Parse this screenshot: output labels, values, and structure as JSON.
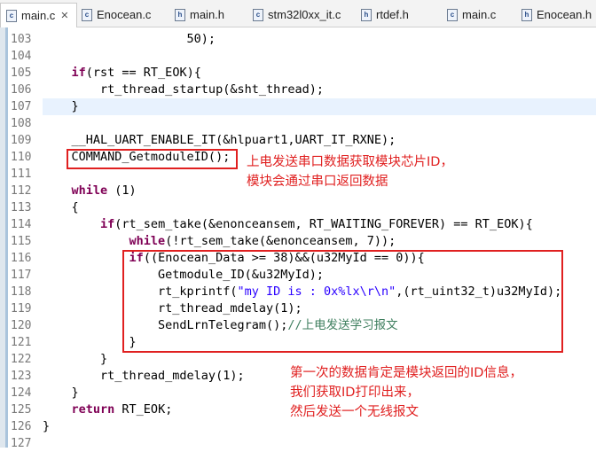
{
  "tabs": [
    {
      "label": "main.c",
      "icon": "c-file-icon",
      "glyph": "c",
      "active": true
    },
    {
      "label": "Enocean.c",
      "icon": "c-file-icon",
      "glyph": "c",
      "active": false
    },
    {
      "label": "main.h",
      "icon": "h-file-icon",
      "glyph": "h",
      "active": false
    },
    {
      "label": "stm32l0xx_it.c",
      "icon": "c-file-icon",
      "glyph": "c",
      "active": false
    },
    {
      "label": "rtdef.h",
      "icon": "h-file-icon",
      "glyph": "h",
      "active": false
    },
    {
      "label": "main.c",
      "icon": "c-file-icon",
      "glyph": "c",
      "active": false
    },
    {
      "label": "Enocean.h",
      "icon": "h-file-icon",
      "glyph": "h",
      "active": false
    }
  ],
  "close_glyph": "✕",
  "code_lines": [
    {
      "num": "103",
      "segs": [
        {
          "t": "                    50);"
        }
      ]
    },
    {
      "num": "104",
      "segs": [
        {
          "t": ""
        }
      ]
    },
    {
      "num": "105",
      "segs": [
        {
          "t": "    ",
          "c": ""
        },
        {
          "t": "if",
          "c": "kw"
        },
        {
          "t": "(rst == RT_EOK){"
        }
      ]
    },
    {
      "num": "106",
      "segs": [
        {
          "t": "        rt_thread_startup(&sht_thread);"
        }
      ]
    },
    {
      "num": "107",
      "segs": [
        {
          "t": "    }"
        }
      ]
    },
    {
      "num": "108",
      "segs": [
        {
          "t": ""
        }
      ]
    },
    {
      "num": "109",
      "segs": [
        {
          "t": "    __HAL_UART_ENABLE_IT(&hlpuart1,UART_IT_RXNE);"
        }
      ]
    },
    {
      "num": "110",
      "segs": [
        {
          "t": "    COMMAND_GetmoduleID();"
        }
      ]
    },
    {
      "num": "111",
      "segs": [
        {
          "t": ""
        }
      ]
    },
    {
      "num": "112",
      "segs": [
        {
          "t": "    "
        },
        {
          "t": "while",
          "c": "kw"
        },
        {
          "t": " (1)"
        }
      ]
    },
    {
      "num": "113",
      "segs": [
        {
          "t": "    {"
        }
      ]
    },
    {
      "num": "114",
      "segs": [
        {
          "t": "        "
        },
        {
          "t": "if",
          "c": "kw"
        },
        {
          "t": "(rt_sem_take(&enonceansem, RT_WAITING_FOREVER) == RT_EOK){"
        }
      ]
    },
    {
      "num": "115",
      "segs": [
        {
          "t": "            "
        },
        {
          "t": "while",
          "c": "kw"
        },
        {
          "t": "(!rt_sem_take(&enonceansem, 7));"
        }
      ]
    },
    {
      "num": "116",
      "segs": [
        {
          "t": "            "
        },
        {
          "t": "if",
          "c": "kw"
        },
        {
          "t": "((Enocean_Data >= 38)&&(u32MyId == 0)){"
        }
      ]
    },
    {
      "num": "117",
      "segs": [
        {
          "t": "                Getmodule_ID(&u32MyId);"
        }
      ]
    },
    {
      "num": "118",
      "segs": [
        {
          "t": "                rt_kprintf("
        },
        {
          "t": "\"my ID is : 0x%lx\\r\\n\"",
          "c": "str"
        },
        {
          "t": ",(rt_uint32_t)u32MyId);"
        }
      ]
    },
    {
      "num": "119",
      "segs": [
        {
          "t": "                rt_thread_mdelay(1);"
        }
      ]
    },
    {
      "num": "120",
      "segs": [
        {
          "t": "                SendLrnTelegram();"
        },
        {
          "t": "//上电发送学习报文",
          "c": "cmt"
        }
      ]
    },
    {
      "num": "121",
      "segs": [
        {
          "t": "            }"
        }
      ]
    },
    {
      "num": "122",
      "segs": [
        {
          "t": "        }"
        }
      ]
    },
    {
      "num": "123",
      "segs": [
        {
          "t": "        rt_thread_mdelay(1);"
        }
      ]
    },
    {
      "num": "124",
      "segs": [
        {
          "t": "    }"
        }
      ]
    },
    {
      "num": "125",
      "segs": [
        {
          "t": "    "
        },
        {
          "t": "return",
          "c": "kw"
        },
        {
          "t": " RT_EOK;"
        }
      ]
    },
    {
      "num": "126",
      "segs": [
        {
          "t": "}"
        }
      ]
    },
    {
      "num": "127",
      "segs": [
        {
          "t": ""
        }
      ]
    }
  ],
  "annotations": {
    "note1": "上电发送串口数据获取模块芯片ID，\n模块会通过串口返回数据",
    "note2": "第一次的数据肯定是模块返回的ID信息，\n我们获取ID打印出来，\n然后发送一个无线报文"
  },
  "colors": {
    "keyword": "#7f0055",
    "string": "#2a00ff",
    "comment": "#3f7f5f",
    "annotation": "#e02020",
    "highlight": "#e8f2fe"
  }
}
